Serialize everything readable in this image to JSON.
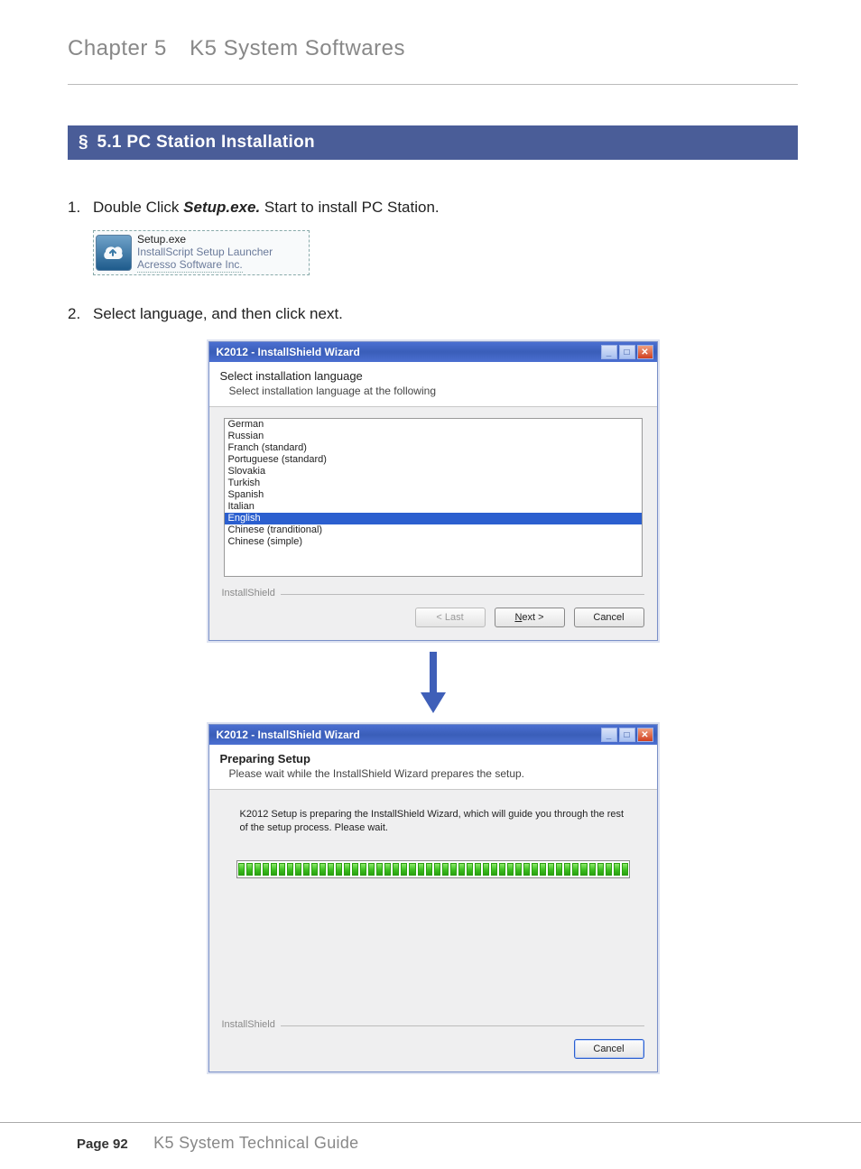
{
  "header": {
    "chapter_label": "Chapter 5",
    "chapter_title": "K5 System Softwares"
  },
  "section": {
    "symbol": "§",
    "number": "5.1",
    "title": "PC Station Installation"
  },
  "steps": {
    "item1_pre": "Double Click ",
    "item1_bold": "Setup.exe.",
    "item1_post": " Start to install PC Station.",
    "item2": "Select language, and then click next."
  },
  "setup_file": {
    "name": "Setup.exe",
    "desc": "InstallScript Setup Launcher",
    "company": "Acresso Software Inc."
  },
  "dialog1": {
    "title": "K2012 - InstallShield Wizard",
    "heading": "Select installation language",
    "subheading": "Select installation language at the following",
    "languages": [
      "German",
      "Russian",
      "Franch (standard)",
      "Portuguese (standard)",
      "Slovakia",
      "Turkish",
      "Spanish",
      "Italian",
      "English",
      "Chinese (tranditional)",
      "Chinese (simple)"
    ],
    "selected_index": 8,
    "brand": "InstallShield",
    "btn_last": "< Last",
    "btn_next_pre": "N",
    "btn_next_post": "ext >",
    "btn_cancel": "Cancel"
  },
  "dialog2": {
    "title": "K2012 - InstallShield Wizard",
    "heading": "Preparing Setup",
    "subheading": "Please wait while the InstallShield Wizard prepares the setup.",
    "message": "K2012 Setup is preparing the InstallShield Wizard, which will guide you through the rest of the setup process. Please wait.",
    "brand": "InstallShield",
    "btn_cancel": "Cancel",
    "progress_segments": 48
  },
  "footer": {
    "page_label": "Page 92",
    "guide_title": "K5 System Technical Guide"
  }
}
